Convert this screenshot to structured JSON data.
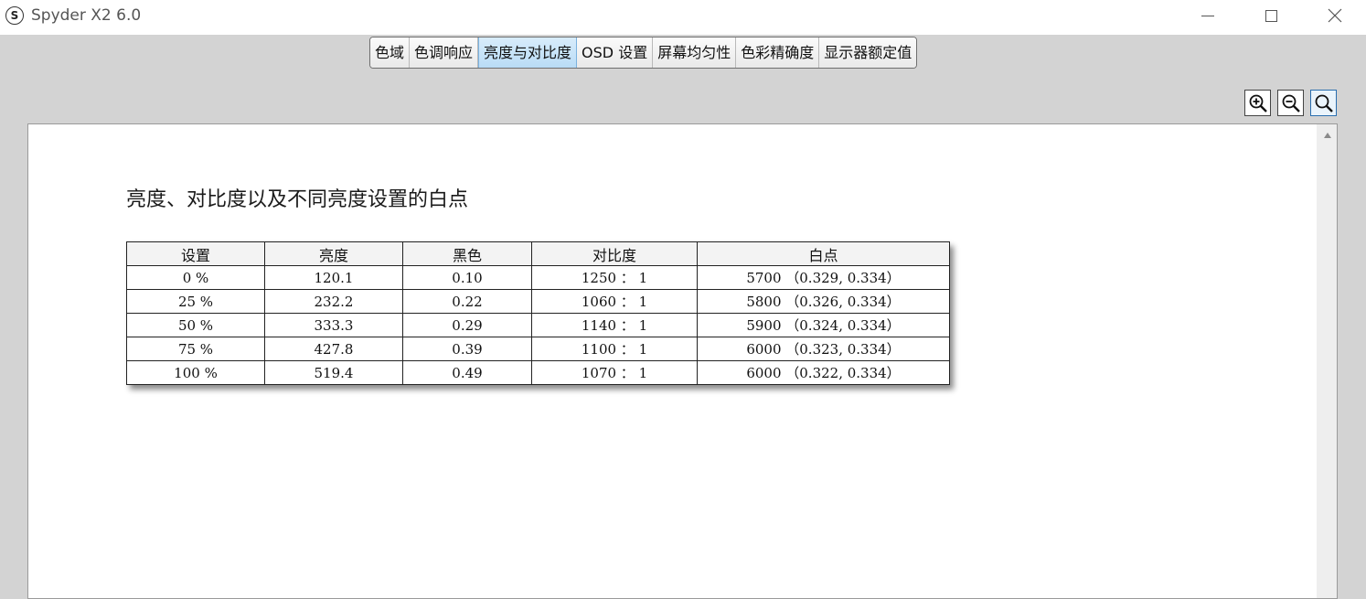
{
  "window": {
    "app_icon_letter": "S",
    "title": "Spyder X2 6.0"
  },
  "tabs": [
    {
      "label": "色域",
      "active": false
    },
    {
      "label": "色调响应",
      "active": false
    },
    {
      "label": "亮度与对比度",
      "active": true
    },
    {
      "label": "OSD 设置",
      "active": false
    },
    {
      "label": "屏幕均匀性",
      "active": false
    },
    {
      "label": "色彩精确度",
      "active": false
    },
    {
      "label": "显示器额定值",
      "active": false
    }
  ],
  "toolbar": {
    "zoom_in_icon": "zoom-in-icon",
    "zoom_out_icon": "zoom-out-icon",
    "zoom_fit_icon": "zoom-fit-icon"
  },
  "report": {
    "title": "亮度、对比度以及不同亮度设置的白点",
    "columns": [
      "设置",
      "亮度",
      "黑色",
      "对比度",
      "白点"
    ],
    "rows": [
      [
        "0 %",
        "120.1",
        "0.10",
        "1250 ： 1",
        "5700 （0.329, 0.334）"
      ],
      [
        "25 %",
        "232.2",
        "0.22",
        "1060 ： 1",
        "5800 （0.326, 0.334）"
      ],
      [
        "50 %",
        "333.3",
        "0.29",
        "1140 ： 1",
        "5900 （0.324, 0.334）"
      ],
      [
        "75 %",
        "427.8",
        "0.39",
        "1100 ： 1",
        "6000 （0.323, 0.334）"
      ],
      [
        "100 %",
        "519.4",
        "0.49",
        "1070 ： 1",
        "6000 （0.322, 0.334）"
      ]
    ]
  },
  "colors": {
    "active_tab": "#b9dcf6",
    "content_bg": "#ffffff",
    "window_bg": "#d3d3d3"
  }
}
